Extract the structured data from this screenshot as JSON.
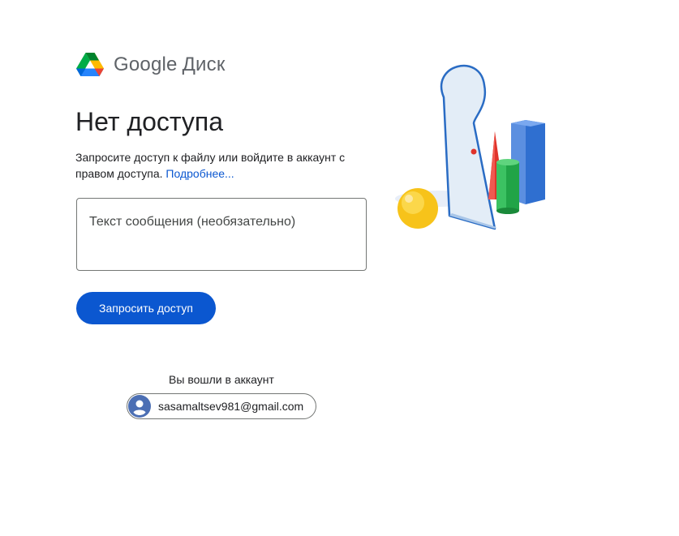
{
  "logo": {
    "brand": "Google",
    "product": "Диск",
    "icon": "google-drive-logo-icon"
  },
  "page": {
    "title": "Нет доступа",
    "description": "Запросите доступ к файлу или войдите в аккаунт с правом доступа.",
    "learn_more": "Подробнее..."
  },
  "message": {
    "placeholder": "Текст сообщения (необязательно)",
    "value": ""
  },
  "request_button": {
    "label": "Запросить доступ"
  },
  "account": {
    "signed_in_label": "Вы вошли в аккаунт",
    "email": "sasamaltsev981@gmail.com",
    "avatar_icon": "account-circle-icon"
  },
  "colors": {
    "accent": "#0b57d0",
    "text": "#202124",
    "border": "#747775"
  }
}
